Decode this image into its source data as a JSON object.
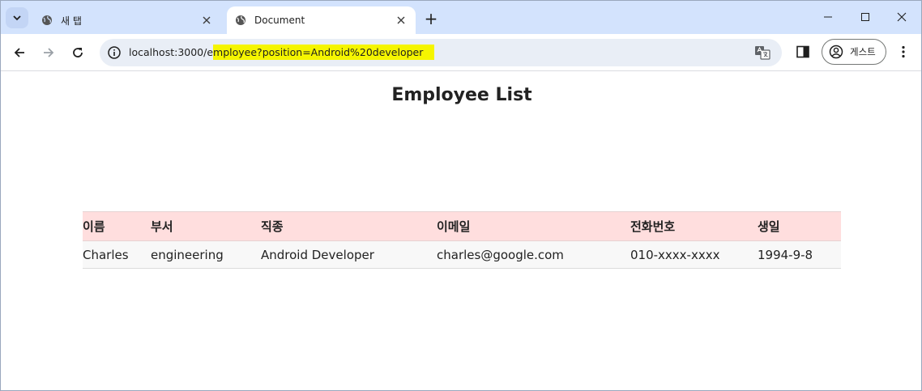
{
  "browser": {
    "tabs": [
      {
        "title": "새 탭",
        "active": false
      },
      {
        "title": "Document",
        "active": true
      }
    ],
    "new_tab_symbol": "+",
    "address_bar": {
      "url_prefix": "localhost:3000/e",
      "url_highlighted": "mployee?position=Android%20developer",
      "highlight_color": "#f5f500"
    },
    "profile_label": "게스트"
  },
  "page": {
    "title": "Employee List",
    "table": {
      "headers": [
        "이름",
        "부서",
        "직종",
        "이메일",
        "전화번호",
        "생일"
      ],
      "rows": [
        [
          "Charles",
          "engineering",
          "Android Developer",
          "charles@google.com",
          "010-xxxx-xxxx",
          "1994-9-8"
        ]
      ],
      "header_bg": "#ffdede"
    }
  },
  "icons": {
    "tab_menu": "chevron-down-icon",
    "tab_favicon": "globe-icon",
    "close": "close-icon",
    "back": "arrow-left-icon",
    "forward": "arrow-right-icon",
    "reload": "reload-icon",
    "info": "info-icon",
    "translate": "translate-icon",
    "side_panel": "side-panel-icon",
    "profile": "person-icon",
    "menu": "kebab-menu-icon"
  }
}
